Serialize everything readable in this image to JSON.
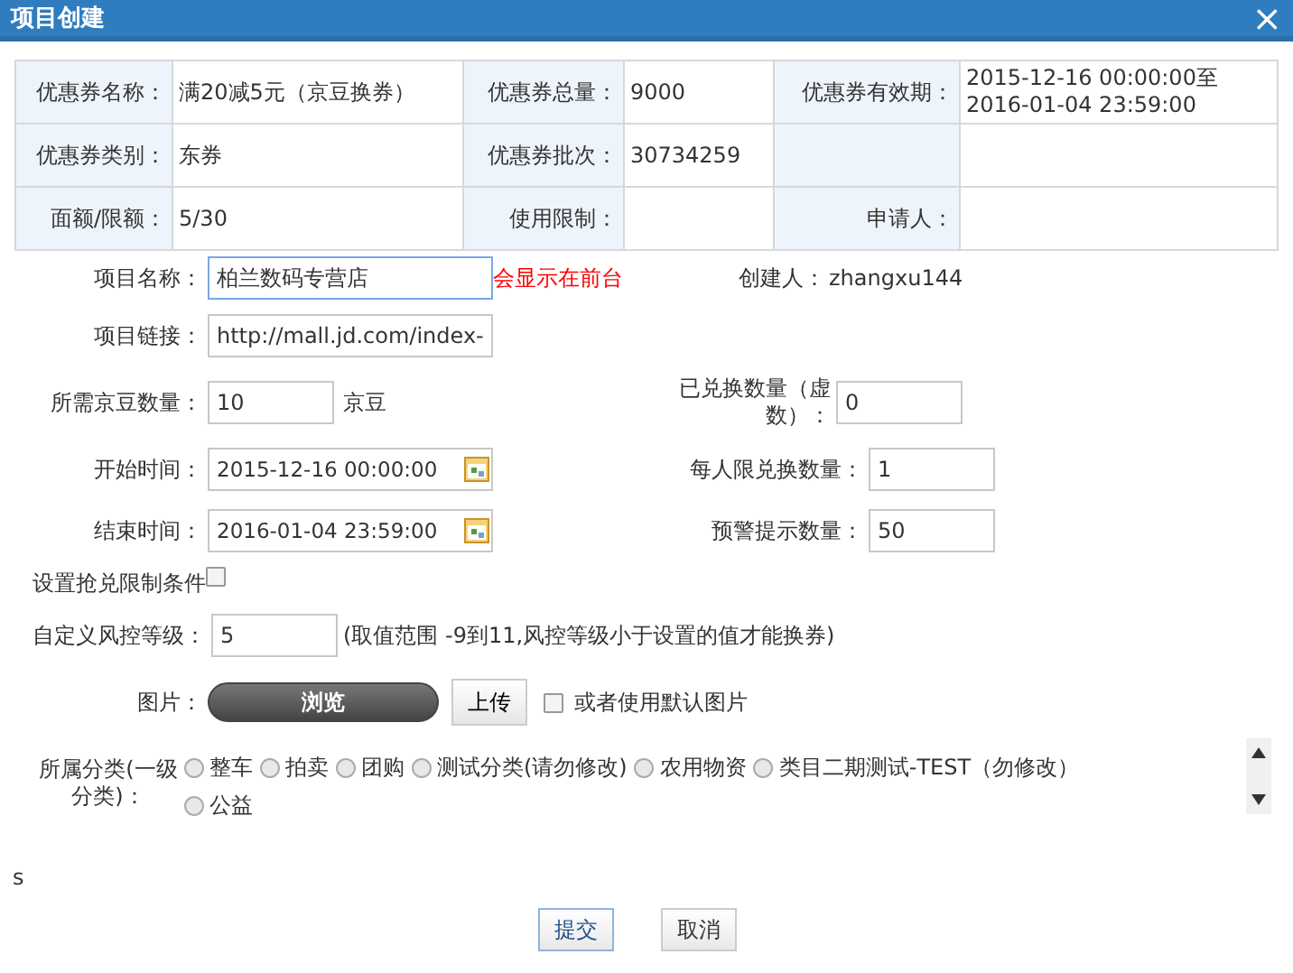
{
  "window": {
    "title": "项目创建",
    "close": "×"
  },
  "coupon_info": [
    [
      {
        "label": "优惠券名称：",
        "value": "满20减5元（京豆换券）"
      },
      {
        "label": "优惠券总量：",
        "value": "9000"
      },
      {
        "label": "优惠券有效期：",
        "value": "2015-12-16 00:00:00至 2016-01-04 23:59:00"
      }
    ],
    [
      {
        "label": "优惠券类别：",
        "value": "东券"
      },
      {
        "label": "优惠券批次：",
        "value": "30734259"
      }
    ],
    [
      {
        "label": "面额/限额：",
        "value": "5/30"
      },
      {
        "label": "使用限制："
      },
      {
        "label": "申请人："
      }
    ]
  ],
  "form": {
    "project_name": {
      "label": "项目名称：",
      "value": "柏兰数码专营店",
      "note": "会显示在前台"
    },
    "creator": {
      "label": "创建人：",
      "value": "zhangxu144"
    },
    "project_link": {
      "label": "项目链接：",
      "value": "http://mall.jd.com/index-"
    },
    "beans_needed": {
      "label": "所需京豆数量：",
      "value": "10",
      "unit": "京豆"
    },
    "redeemed": {
      "label": "已兑换数量（虚数）：",
      "value": "0"
    },
    "start_time": {
      "label": "开始时间：",
      "value": "2015-12-16 00:00:00"
    },
    "per_person_limit": {
      "label": "每人限兑换数量：",
      "value": "1"
    },
    "end_time": {
      "label": "结束时间：",
      "value": "2016-01-04 23:59:00"
    },
    "warning_count": {
      "label": "预警提示数量：",
      "value": "50"
    },
    "limit_conditions": {
      "label": "设置抢兑限制条件",
      "checked": false
    },
    "risk_level": {
      "label": "自定义风控等级：",
      "value": "5",
      "hint": "(取值范围 -9到11,风控等级小于设置的值才能换券)"
    },
    "picture": {
      "label": "图片：",
      "browse": "浏览",
      "upload": "上传",
      "default_label": "或者使用默认图片",
      "default_checked": false
    },
    "category": {
      "label": "所属分类(一级分类)：",
      "options": [
        {
          "label": "整车",
          "selected": false
        },
        {
          "label": "拍卖",
          "selected": false
        },
        {
          "label": "团购",
          "selected": false
        },
        {
          "label": "测试分类(请勿修改)",
          "selected": false
        },
        {
          "label": "农用物资",
          "selected": false
        },
        {
          "label": "类目二期测试-TEST（勿修改）",
          "selected": false
        },
        {
          "label": "公益",
          "selected": false
        }
      ]
    }
  },
  "stray_text": "s",
  "buttons": [
    {
      "label": "提交",
      "focused": true
    },
    {
      "label": "取消",
      "focused": false
    }
  ]
}
